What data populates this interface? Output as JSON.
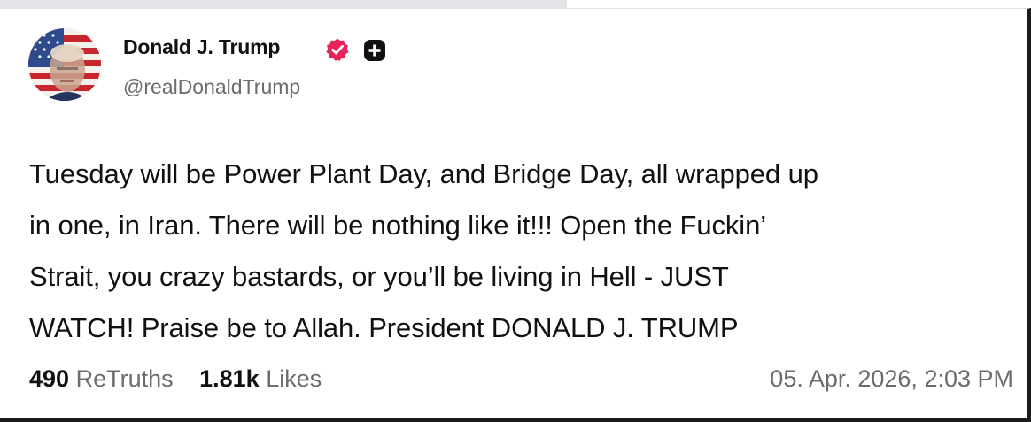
{
  "author": {
    "display_name": "Donald J. Trump",
    "handle": "@realDonaldTrump",
    "verified_icon": "verified-badge-icon",
    "verified_color": "#e6245a",
    "plus_icon": "plus-badge-icon"
  },
  "post": {
    "lines": [
      "Tuesday will be Power Plant Day, and Bridge Day, all wrapped up",
      "in one, in Iran. There will be nothing like it!!! Open the Fuckin’",
      "Strait, you crazy bastards, or you’ll be living in Hell - JUST",
      "WATCH! Praise be to Allah. President DONALD J. TRUMP"
    ]
  },
  "stats": {
    "retruths_count": "490",
    "retruths_label": "ReTruths",
    "likes_count": "1.81k",
    "likes_label": "Likes"
  },
  "timestamp": "05. Apr. 2026, 2:03 PM"
}
